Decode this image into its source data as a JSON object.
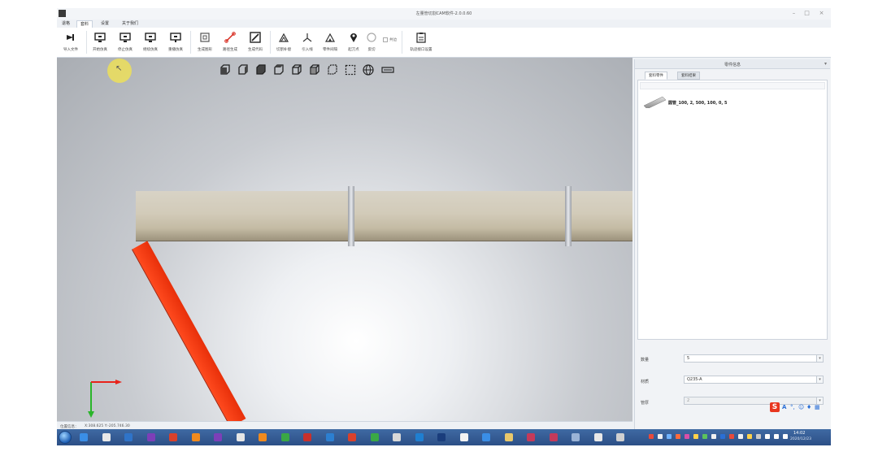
{
  "window": {
    "title": "左量管切割CAM软件-2.0.0.60"
  },
  "menu": {
    "items": [
      "退格",
      "套料",
      "设置",
      "关于我们"
    ],
    "active_index": 1
  },
  "ribbon": {
    "tools": [
      {
        "label": "导入文件",
        "icon": "import-icon"
      },
      {
        "label": "开始仿真",
        "icon": "monitor-icon"
      },
      {
        "label": "停止仿真",
        "icon": "monitor-icon"
      },
      {
        "label": "继续仿真",
        "icon": "monitor-icon"
      },
      {
        "label": "重播仿真",
        "icon": "monitor-icon"
      },
      {
        "label": "生成图形",
        "icon": "frame-icon"
      },
      {
        "label": "路径生成",
        "icon": "path-icon"
      },
      {
        "label": "生成代码",
        "icon": "pen-icon"
      },
      {
        "label": "切割补偿",
        "icon": "compensation-icon"
      },
      {
        "label": "引入线",
        "icon": "lead-in-icon"
      },
      {
        "label": "零件间隔",
        "icon": "spacing-icon"
      },
      {
        "label": "起刀点",
        "icon": "start-point-icon"
      },
      {
        "label": "反切",
        "icon": "circle-icon"
      },
      {
        "label": "轨迹接口设置",
        "icon": "clipboard-icon"
      }
    ],
    "checkbox_label": "共边"
  },
  "status": {
    "label": "位置信息：",
    "value": "X:308.625 Y:-205.746.30"
  },
  "panel": {
    "title": "零件信息",
    "tabs": [
      "套料零件",
      "套料结果"
    ],
    "active_tab": 0,
    "part": "圆管_100, 2, 500, 100, 0, 5",
    "fields": [
      {
        "label": "数量",
        "value": "5",
        "disabled": false
      },
      {
        "label": "材质",
        "value": "Q235-A",
        "disabled": false
      },
      {
        "label": "管厚",
        "value": "2",
        "disabled": true
      }
    ]
  },
  "ime": {
    "logo": "S",
    "mode": "A"
  },
  "taskbar": {
    "time": "14:02",
    "date": "2020/12/23",
    "apps": [
      "ie-icon",
      "tool-icon",
      "visual-studio-icon",
      "visual-studio-icon",
      "office-icon",
      "firefox-icon",
      "visual-studio-icon",
      "chrome-icon",
      "firefox-icon",
      "shield-icon",
      "acrobat-icon",
      "vs-code-icon",
      "office-icon",
      "wechat-icon",
      "settings-icon",
      "browser-icon",
      "photoshop-icon",
      "notepad-icon",
      "chrome-icon",
      "folder-icon",
      "screenshot-icon",
      "screenshot-icon",
      "disk-icon",
      "network-icon",
      "cmd-icon"
    ]
  }
}
